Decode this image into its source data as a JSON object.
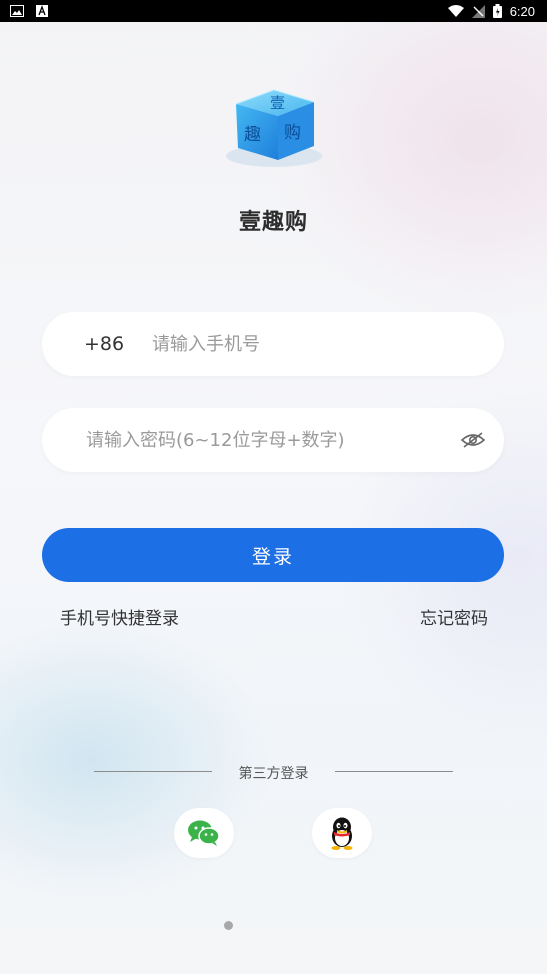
{
  "status_bar": {
    "time": "6:20"
  },
  "app": {
    "name": "壹趣购",
    "logo_text": [
      "壹",
      "趣",
      "购"
    ],
    "brand_color": "#1d6fe6"
  },
  "phone_field": {
    "country_code": "+86",
    "placeholder": "请输入手机号",
    "value": ""
  },
  "password_field": {
    "placeholder": "请输入密码(6~12位字母+数字)",
    "value": "",
    "visibility_icon": "eye-off-icon"
  },
  "login_button": {
    "label": "登录"
  },
  "links": {
    "quick_login": "手机号快捷登录",
    "forgot_password": "忘记密码"
  },
  "third_party": {
    "title": "第三方登录",
    "providers": [
      {
        "name": "wechat",
        "icon": "wechat-icon"
      },
      {
        "name": "qq",
        "icon": "qq-icon"
      }
    ]
  },
  "pagination": {
    "current_page": 1
  }
}
